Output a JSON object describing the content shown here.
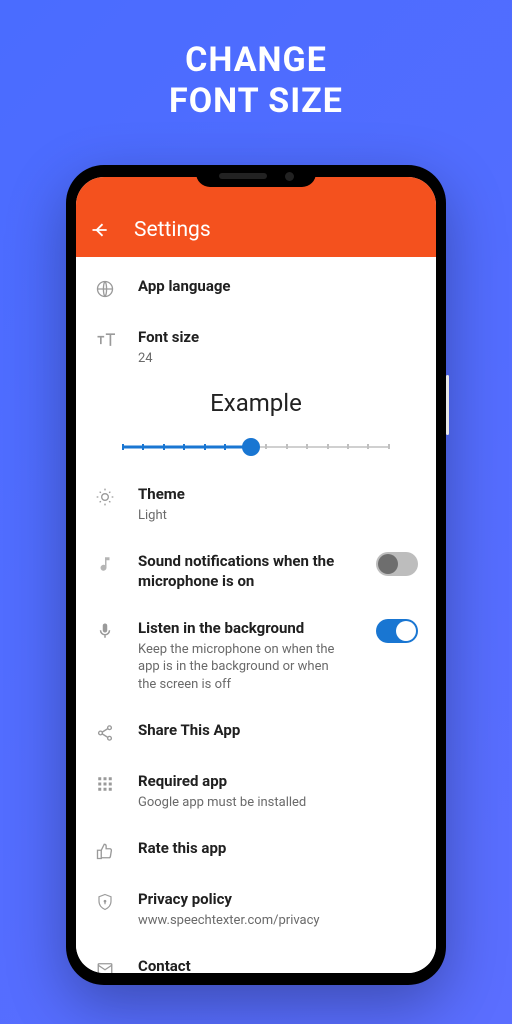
{
  "promo": {
    "line1": "CHANGE",
    "line2": "FONT SIZE"
  },
  "appbar": {
    "title": "Settings"
  },
  "settings": {
    "language": {
      "title": "App language"
    },
    "fontsize": {
      "title": "Font size",
      "value": "24"
    },
    "example": {
      "text": "Example"
    },
    "slider": {
      "percent": 48
    },
    "theme": {
      "title": "Theme",
      "value": "Light"
    },
    "sound": {
      "title": "Sound notifications when the microphone is on",
      "on": false
    },
    "listen": {
      "title": "Listen in the background",
      "sub": "Keep the microphone on when the app is in the background or when the screen is off",
      "on": true
    },
    "share": {
      "title": "Share This App"
    },
    "required": {
      "title": "Required app",
      "sub": "Google app must be installed"
    },
    "rate": {
      "title": "Rate this app"
    },
    "privacy": {
      "title": "Privacy policy",
      "sub": "www.speechtexter.com/privacy"
    },
    "contact": {
      "title": "Contact"
    }
  },
  "colors": {
    "accent": "#F4511E",
    "primary": "#1976D2"
  }
}
